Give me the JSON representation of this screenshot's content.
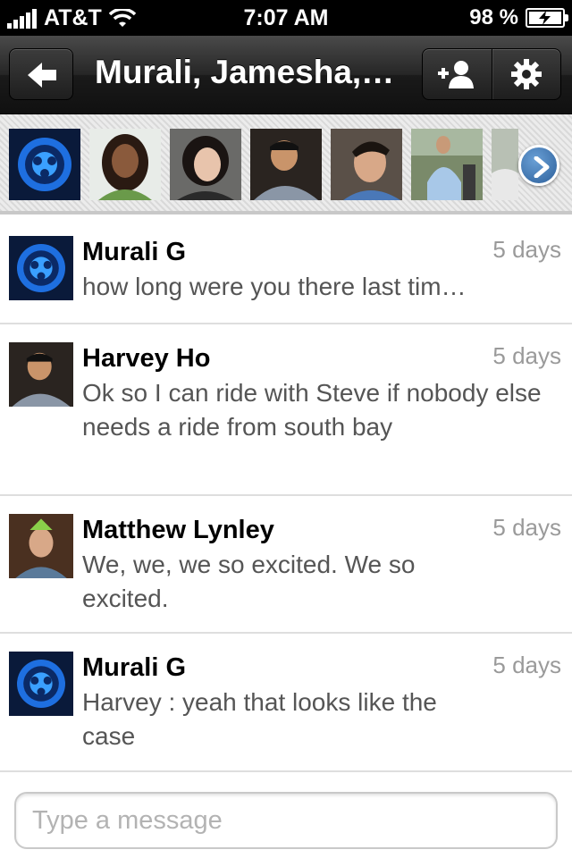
{
  "status_bar": {
    "carrier": "AT&T",
    "time": "7:07 AM",
    "battery": "98 %"
  },
  "nav": {
    "title": "Murali, Jamesha,…",
    "icons": {
      "back": "back-arrow-icon",
      "add": "add-person-icon",
      "settings": "gear-icon",
      "more": "chevron-right-icon"
    }
  },
  "participants": [
    "avatar-1",
    "avatar-2",
    "avatar-3",
    "avatar-4",
    "avatar-5",
    "avatar-6"
  ],
  "messages": [
    {
      "name": "Murali G",
      "time": "5 days",
      "text": "how long were you there last tim…"
    },
    {
      "name": "Harvey Ho",
      "time": "5 days",
      "text": "Ok so I can ride with Steve if nobody else needs a ride from south bay"
    },
    {
      "name": "Matthew Lynley",
      "time": "5 days",
      "text": "We, we, we so excited. We so excited."
    },
    {
      "name": "Murali G",
      "time": "5 days",
      "text": "Harvey : yeah that looks like the case"
    }
  ],
  "input": {
    "placeholder": "Type a message",
    "value": ""
  },
  "colors": {
    "nav_dark": "#1a1a1a",
    "time_gray": "#9a9a9a",
    "text_gray": "#555555",
    "more_blue": "#2c5f9a"
  }
}
